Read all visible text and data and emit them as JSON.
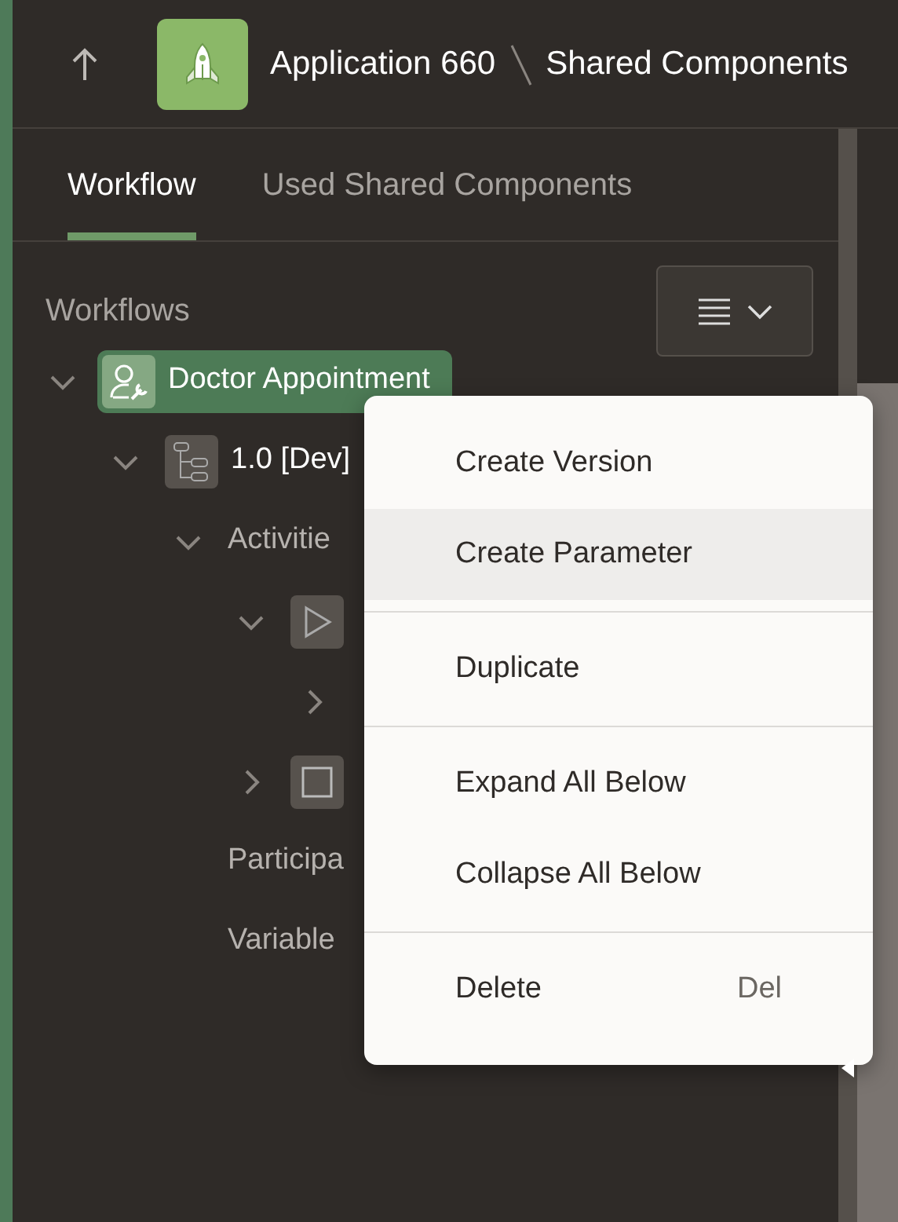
{
  "header": {
    "breadcrumbs": [
      "Application 660",
      "Shared Components"
    ]
  },
  "tabs": [
    {
      "label": "Workflow",
      "selected": true
    },
    {
      "label": "Used Shared Components",
      "selected": false
    }
  ],
  "tree": {
    "heading": "Workflows",
    "nodes": [
      {
        "label": "Doctor Appointment",
        "kind": "workflow",
        "selected": true,
        "expanded": true,
        "children": [
          {
            "label": "1.0 [Dev]",
            "kind": "version",
            "selected": false,
            "expanded": true,
            "children": [
              {
                "label": "Activitie",
                "selected": false,
                "expanded": true,
                "children": [
                  {
                    "kind": "start",
                    "selected": false,
                    "expanded": true,
                    "children": [
                      {
                        "selected": false,
                        "expanded": false
                      }
                    ]
                  },
                  {
                    "kind": "end",
                    "selected": false,
                    "expanded": false
                  }
                ]
              },
              {
                "label": "Participa",
                "selected": false
              },
              {
                "label": "Variable",
                "selected": false
              }
            ]
          }
        ]
      }
    ]
  },
  "context_menu": {
    "groups": [
      [
        {
          "label": "Create Version",
          "selected": false
        },
        {
          "label": "Create Parameter",
          "selected": true
        }
      ],
      [
        {
          "label": "Duplicate",
          "selected": false
        }
      ],
      [
        {
          "label": "Expand All Below",
          "selected": false
        },
        {
          "label": "Collapse All Below",
          "selected": false
        }
      ],
      [
        {
          "label": "Delete",
          "shortcut": "Del",
          "selected": false
        }
      ]
    ]
  }
}
